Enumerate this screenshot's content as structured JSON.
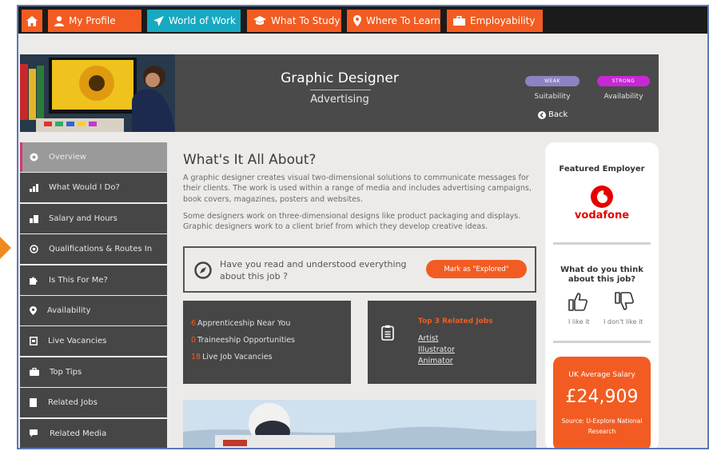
{
  "nav": {
    "tabs": [
      {
        "label": "My Profile",
        "icon": "user-icon"
      },
      {
        "label": "World of Work",
        "icon": "paper-plane-icon"
      },
      {
        "label": "What To Study",
        "icon": "graduation-cap-icon"
      },
      {
        "label": "Where To Learn",
        "icon": "map-pin-icon"
      },
      {
        "label": "Employability",
        "icon": "briefcase-icon"
      }
    ],
    "home_icon": "home-icon"
  },
  "hero": {
    "title": "Graphic Designer",
    "sector": "Advertising",
    "suitability": {
      "pill": "WEAK",
      "label": "Suitability",
      "color": "#8c83c2"
    },
    "availability": {
      "pill": "STRONG",
      "label": "Availability",
      "color": "#c828d4"
    },
    "back_label": "Back"
  },
  "sidebar": {
    "items": [
      {
        "label": "Overview",
        "icon": "circle-icon"
      },
      {
        "label": "What Would I Do?",
        "icon": "bar-chart-icon"
      },
      {
        "label": "Salary and Hours",
        "icon": "money-icon"
      },
      {
        "label": "Qualifications & Routes In",
        "icon": "target-icon"
      },
      {
        "label": "Is This For Me?",
        "icon": "puzzle-icon"
      },
      {
        "label": "Availability",
        "icon": "location-icon"
      },
      {
        "label": "Live Vacancies",
        "icon": "door-icon"
      },
      {
        "label": "Top Tips",
        "icon": "briefcase-icon"
      },
      {
        "label": "Related Jobs",
        "icon": "book-icon"
      },
      {
        "label": "Related Media",
        "icon": "chat-icon"
      }
    ]
  },
  "main": {
    "heading": "What's It All About?",
    "paragraph1": "A graphic designer creates visual two-dimensional solutions to communicate messages for their clients. The work is used within a range of media and includes advertising campaigns, book covers, magazines, posters and websites.",
    "paragraph2": "Some designers work on three-dimensional designs like product packaging and displays. Graphic designers work to a client brief from which they develop creative ideas.",
    "explored_question": "Have you read and understood everything about this job ?",
    "mark_button": "Mark as \"Explored\"",
    "stats": [
      {
        "count": "6",
        "label": "Apprenticeship Near You"
      },
      {
        "count": "0",
        "label": "Traineeship Opportunities"
      },
      {
        "count": "18",
        "label": "Live Job Vacancies"
      }
    ],
    "related_title": "Top 3 Related Jobs",
    "related_jobs": [
      "Artist",
      "Illustrator",
      "Animator"
    ]
  },
  "right": {
    "featured_title": "Featured Employer",
    "employer_name": "vodafone",
    "opinion_title": "What do you think about this job?",
    "like_label": "I like it",
    "dislike_label": "I don't like it",
    "salary_label": "UK Average Salary",
    "salary_value": "£24,909",
    "salary_source": "Source: U-Explore National Research"
  },
  "colors": {
    "accent": "#f25c22",
    "teal": "#17a9c1",
    "panel": "#464646",
    "brand_red": "#e60000"
  }
}
